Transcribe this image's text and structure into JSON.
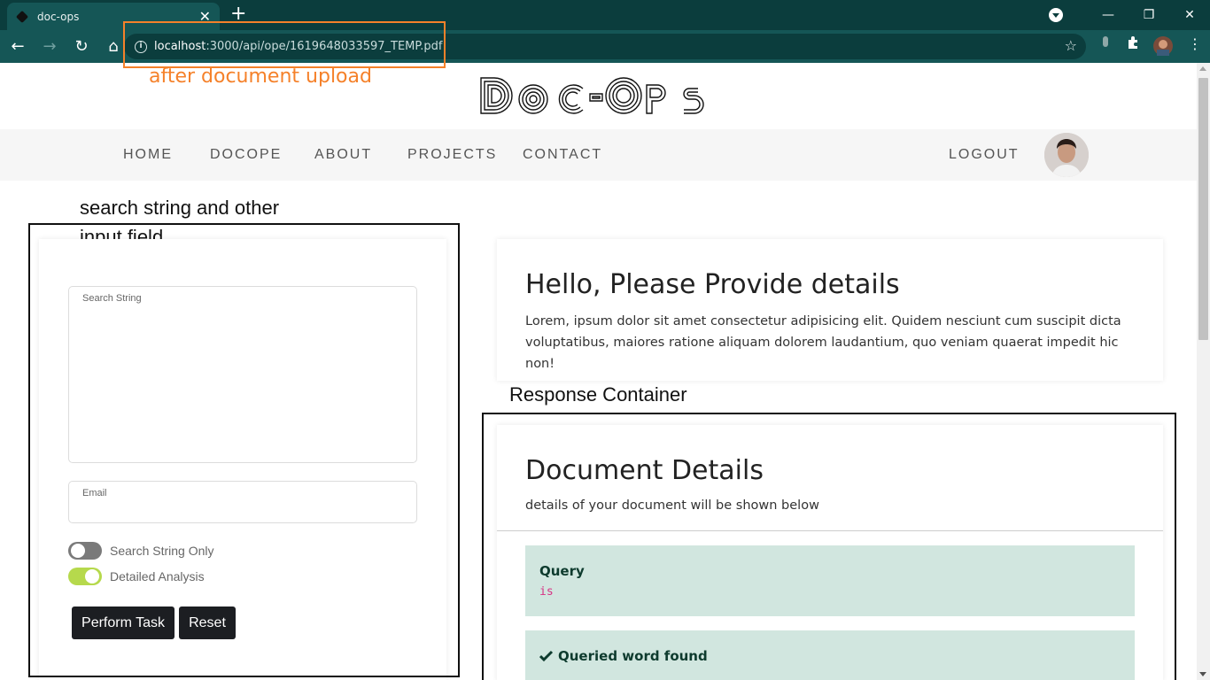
{
  "browser": {
    "tab_title": "doc-ops",
    "tab_close": "✕",
    "new_tab": "+",
    "url_host": "localhost",
    "url_path": ":3000/api/ope/1619648033597_TEMP.pdf",
    "window_minimize": "—",
    "window_restore": "❐",
    "window_close": "✕",
    "back": "←",
    "forward": "→",
    "reload": "↻",
    "home": "⌂",
    "star": "☆"
  },
  "annotations": {
    "url_note": "after document upload",
    "left_note_line1": "search string and other",
    "left_note_line2": "input field",
    "right_note": "Response Container"
  },
  "site": {
    "logo_text": "DOC-OPS",
    "nav": [
      "HOME",
      "DOCOPE",
      "ABOUT",
      "PROJECTS",
      "CONTACT"
    ],
    "logout": "LOGOUT"
  },
  "form": {
    "search_label": "Search String",
    "email_label": "Email",
    "toggle_search_only": {
      "label": "Search String Only",
      "on": false
    },
    "toggle_detailed": {
      "label": "Detailed Analysis",
      "on": true
    },
    "perform_button": "Perform Task",
    "reset_button": "Reset",
    "toggle_on_color": "#b6d94c",
    "toggle_off_color": "#7a7a7a"
  },
  "hello": {
    "heading": "Hello, Please Provide details",
    "text": "Lorem, ipsum dolor sit amet consectetur adipisicing elit. Quidem nesciunt cum suscipit dicta voluptatibus, maiores ratione aliquam dolorem laudantium, quo veniam quaerat impedit hic non!"
  },
  "details": {
    "heading": "Document Details",
    "subtitle": "details of your document will be shown below",
    "query_title": "Query",
    "query_value": "is",
    "found_title": "Queried word found",
    "alert_color": "#d1e6df"
  }
}
